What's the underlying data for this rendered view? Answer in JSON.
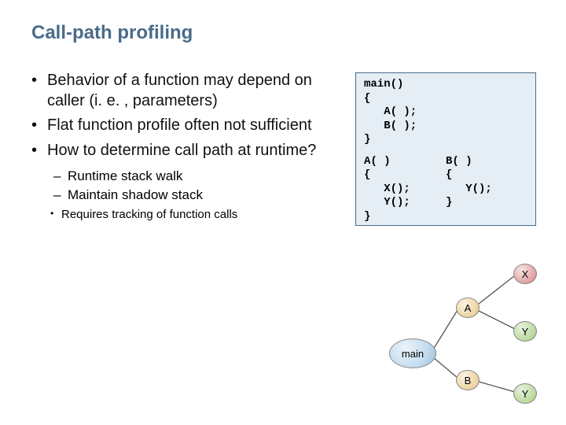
{
  "title": "Call-path profiling",
  "bullets": [
    "Behavior of a function may depend on caller (i. e. , parameters)",
    "Flat function profile often not sufficient",
    "How to determine call path at runtime?"
  ],
  "sub": [
    "Runtime stack walk",
    "Maintain shadow stack"
  ],
  "subsub": [
    "Requires tracking of function calls"
  ],
  "code": {
    "main": "main()\n{\n   A( );\n   B( );\n}",
    "a": "A( )\n{\n   X();\n   Y();\n}",
    "b": "B( )\n{\n   Y();\n}"
  },
  "nodes": {
    "main": "main",
    "a": "A",
    "b": "B",
    "x": "X",
    "y1": "Y",
    "y2": "Y"
  }
}
